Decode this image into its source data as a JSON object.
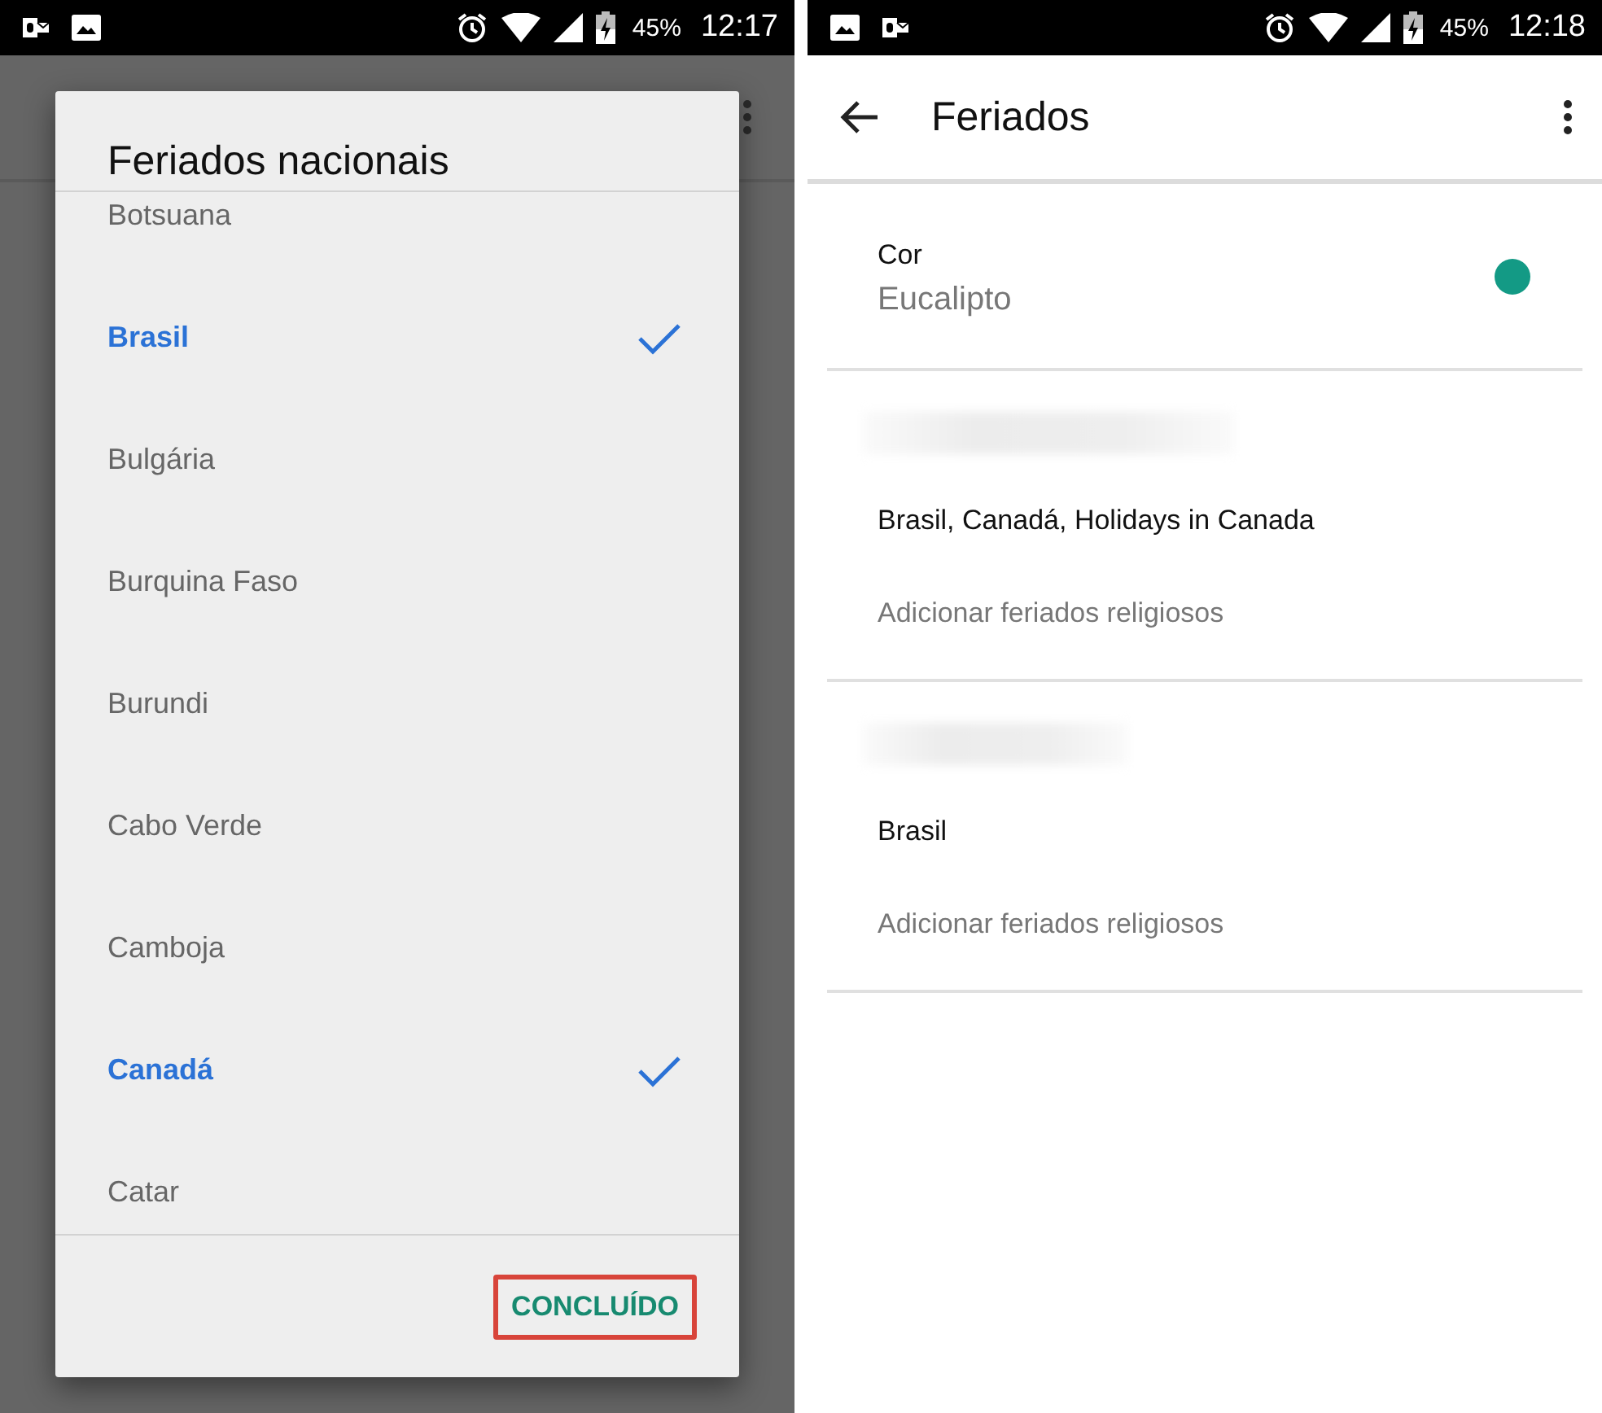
{
  "left_screen": {
    "status_bar": {
      "notification_icons": [
        {
          "kind": "mail"
        },
        {
          "kind": "image"
        }
      ],
      "battery": "45%",
      "time": "12:17"
    },
    "dialog": {
      "title": "Feriados nacionais",
      "items": [
        {
          "label": "Botsuana",
          "selected": false
        },
        {
          "label": "Brasil",
          "selected": true
        },
        {
          "label": "Bulgária",
          "selected": false
        },
        {
          "label": "Burquina Faso",
          "selected": false
        },
        {
          "label": "Burundi",
          "selected": false
        },
        {
          "label": "Cabo Verde",
          "selected": false
        },
        {
          "label": "Camboja",
          "selected": false
        },
        {
          "label": "Canadá",
          "selected": true
        },
        {
          "label": "Catar",
          "selected": false
        }
      ],
      "button": "CONCLUÍDO"
    }
  },
  "right_screen": {
    "status_bar": {
      "notification_icons": [
        {
          "kind": "image"
        },
        {
          "kind": "mail"
        }
      ],
      "battery": "45%",
      "time": "12:18"
    },
    "app_bar": {
      "title": "Feriados"
    },
    "color_setting": {
      "label": "Cor",
      "value": "Eucalipto",
      "color": "#139a85"
    },
    "sections": [
      {
        "calendars": "Brasil, Canadá, Holidays in Canada",
        "action": "Adicionar feriados religiosos"
      },
      {
        "calendars": "Brasil",
        "action": "Adicionar feriados religiosos"
      }
    ]
  }
}
